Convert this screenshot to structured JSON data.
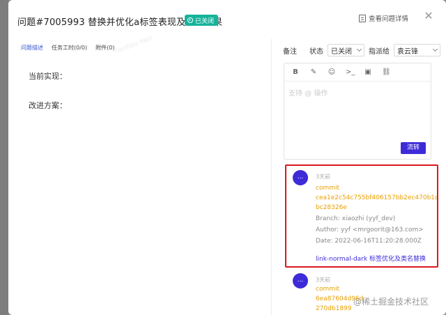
{
  "header": {
    "title": "问题#7005993  替换并优化a标签表现及点击效果",
    "status_badge": "已关闭",
    "view_detail": "查看问题详情",
    "close_icon": "close-icon"
  },
  "left": {
    "tabs": [
      {
        "label": "问题描述",
        "active": true
      },
      {
        "label": "任务工时(0/0)",
        "active": false
      },
      {
        "label": "附件(0)",
        "active": false
      }
    ],
    "description": {
      "current": "当前实现：",
      "improve": "改进方案："
    }
  },
  "right": {
    "note_label": "备注",
    "status_label": "状态",
    "status_value": "已关闭",
    "assignee_label": "指派给",
    "assignee_value": "袁云锋",
    "editor": {
      "toolbar": [
        "B",
        "✎",
        "☺",
        ">_",
        "▣",
        "⛓"
      ],
      "placeholder": "支持 @ 操作",
      "submit": "流转"
    },
    "activities": [
      {
        "avatar": "...",
        "time": "3天前",
        "commit_label": "commit",
        "hash_line1": "cea1e2c54c755bf406157bb2ec470b1d",
        "hash_line2": "bc28326e",
        "branch": "Branch: xiaozhi (yyf_dev)",
        "author": "Author: yyf <mrgoorit@163.com>",
        "date": "Date: 2022-06-16T11:20:28.000Z",
        "message": "link-normal-dark 标签优化及类名替换"
      },
      {
        "avatar": "...",
        "time": "3天前",
        "commit_label": "commit",
        "hash_line1": "6ea87604d96d",
        "hash_line2": "270db1899"
      }
    ]
  },
  "footer_watermark": "@稀土掘金技术社区",
  "colors": {
    "accent": "#3e2bd8",
    "status_green": "#17b39b",
    "commit_orange": "#e9a000",
    "highlight_red": "#d9191c"
  }
}
